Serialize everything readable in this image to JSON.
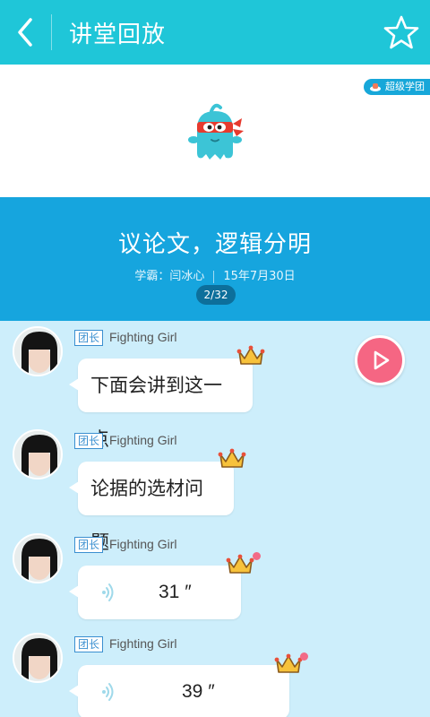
{
  "header": {
    "title": "讲堂回放",
    "back_icon": "chevron-left-icon",
    "favorite_icon": "star-outline-icon"
  },
  "banner": {
    "badge_label": "超级学团",
    "lesson_title": "议论文，逻辑分明",
    "teacher": "学霸：闫冰心",
    "date": "15年7月30日",
    "page_indicator": "2/32"
  },
  "messages": [
    {
      "role": "团长",
      "user": "Fighting Girl",
      "type": "text",
      "text": "下面会讲到这一点"
    },
    {
      "role": "团长",
      "user": "Fighting Girl",
      "type": "text",
      "text": "论据的选材问题"
    },
    {
      "role": "团长",
      "user": "Fighting Girl",
      "type": "voice",
      "duration": "31 ″",
      "unread": true
    },
    {
      "role": "团长",
      "user": "Fighting Girl",
      "type": "voice",
      "duration": "39 ″",
      "unread": true
    }
  ],
  "colors": {
    "header_bg": "#1fc6d8",
    "banner_blue": "#16a5de",
    "chat_bg": "#cdeefb",
    "play_button": "#f56683"
  }
}
